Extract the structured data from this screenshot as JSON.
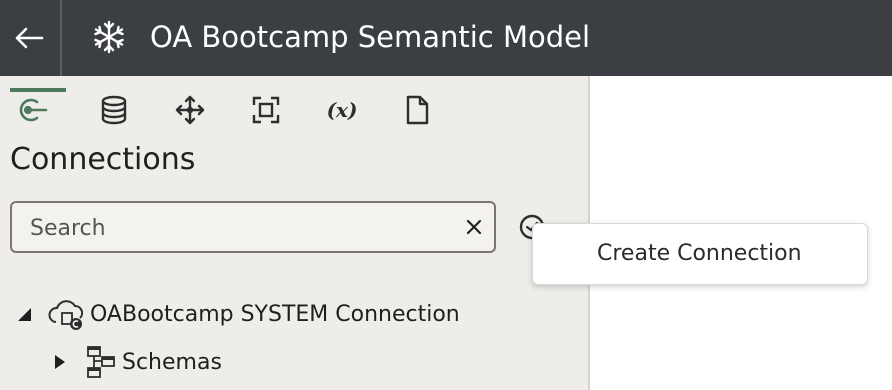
{
  "header": {
    "back_icon": "arrow-left-icon",
    "model_icon": "snowflake-icon",
    "title": "OA Bootcamp Semantic Model"
  },
  "toolbar": {
    "items": [
      {
        "name": "connections",
        "icon": "connection-plug-icon",
        "active": true
      },
      {
        "name": "database",
        "icon": "database-icon",
        "active": false
      },
      {
        "name": "hierarchy",
        "icon": "move-arrows-icon",
        "active": false
      },
      {
        "name": "frame",
        "icon": "focus-frame-icon",
        "active": false
      },
      {
        "name": "variables",
        "icon": "variable-icon",
        "label": "(x)",
        "active": false
      },
      {
        "name": "document",
        "icon": "document-icon",
        "active": false
      }
    ]
  },
  "panel": {
    "heading": "Connections",
    "search": {
      "placeholder": "Search",
      "value": ""
    }
  },
  "tree": [
    {
      "label": "OABootcamp SYSTEM Connection",
      "expanded": true,
      "icon": "cloud-connection-icon"
    },
    {
      "label": "Schemas",
      "expanded": false,
      "icon": "schema-icon"
    }
  ],
  "menu": {
    "items": [
      {
        "label": "Create Connection"
      }
    ]
  },
  "colors": {
    "header_bg": "#3b3f44",
    "panel_bg": "#efede9",
    "accent": "#4c7a5a"
  }
}
